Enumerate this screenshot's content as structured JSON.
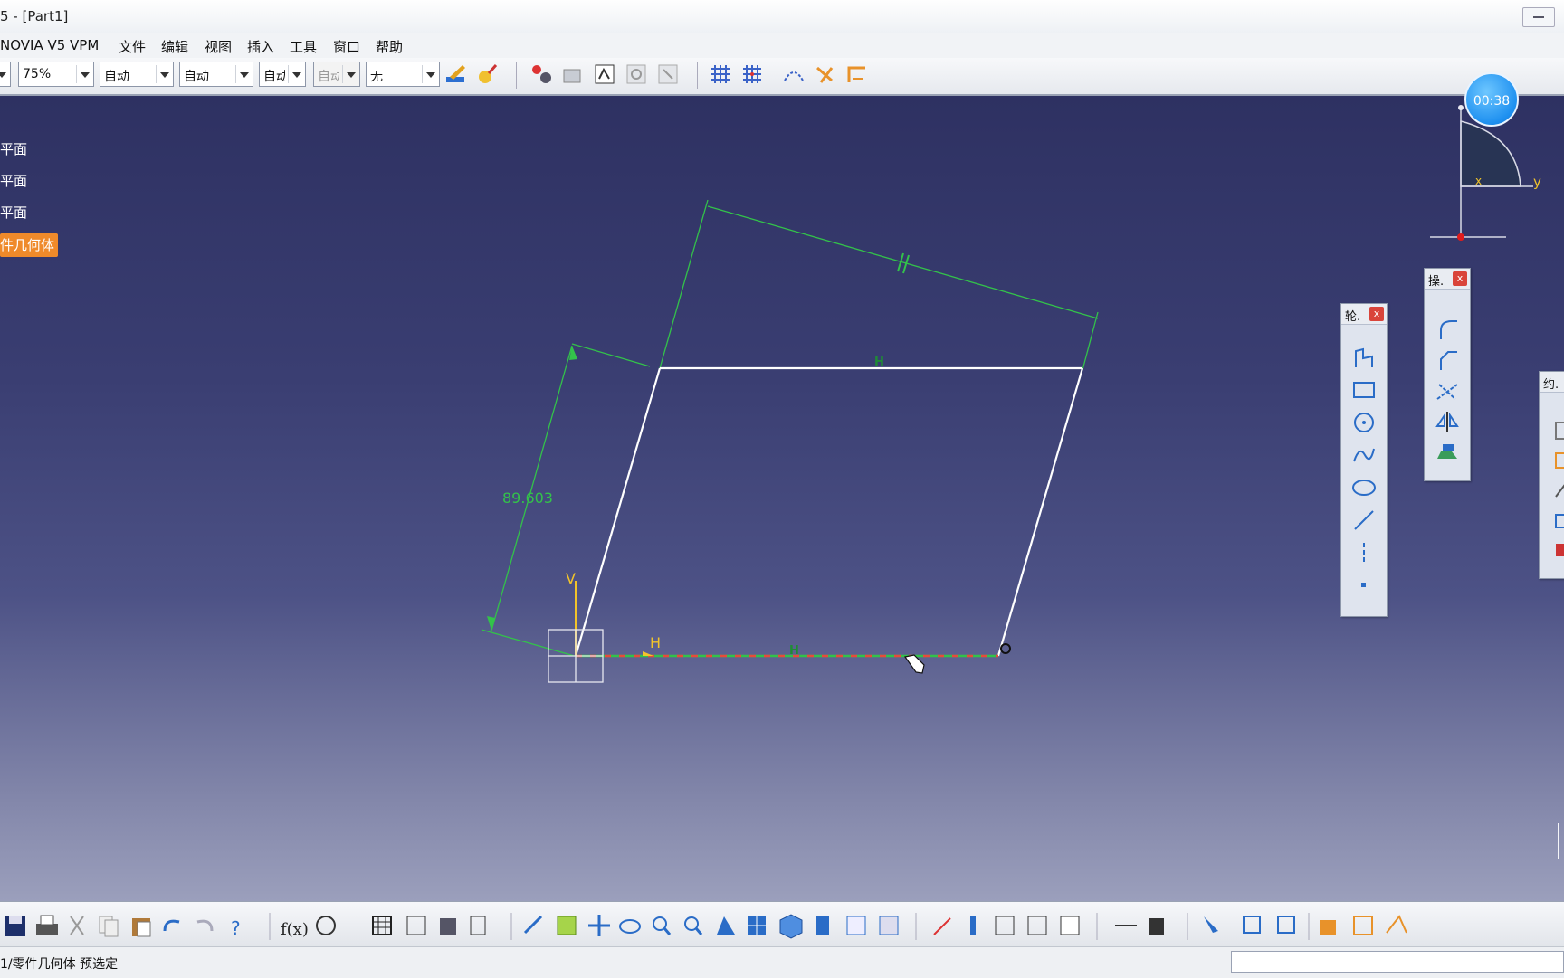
{
  "window": {
    "title": "5 - [Part1]"
  },
  "menu": {
    "enovia": "NOVIA V5 VPM",
    "file": "文件",
    "edit": "编辑",
    "view": "视图",
    "insert": "插入",
    "tools": "工具",
    "window": "窗口",
    "help": "帮助"
  },
  "toolbar": {
    "zoom": "75%",
    "line_type": "自动",
    "line_weight": "自动",
    "color": "自动",
    "layer": "自动",
    "render": "无"
  },
  "tree": {
    "items": [
      "平面",
      "平面",
      "平面",
      "件几何体"
    ]
  },
  "sketch": {
    "dimension_value": "89.603",
    "constraint_h": "H",
    "h_direction": "H",
    "axis_v": "V"
  },
  "compass": {
    "x_label": "x",
    "y_label": "y"
  },
  "timer": {
    "value": "00:38"
  },
  "palettes": {
    "profile_title": "轮.",
    "operation_title": "操.",
    "constraint_title": "约.",
    "close": "x"
  },
  "status": {
    "text": "1/零件几何体 预选定"
  },
  "colors": {
    "viewport_top": "#2e3162",
    "viewport_bottom": "#9b9fbc",
    "sketch_line": "#ffffff",
    "dimension_green": "#33c24a",
    "selected_orange": "#ef8a2a",
    "axis_yellow": "#f2c42a"
  }
}
